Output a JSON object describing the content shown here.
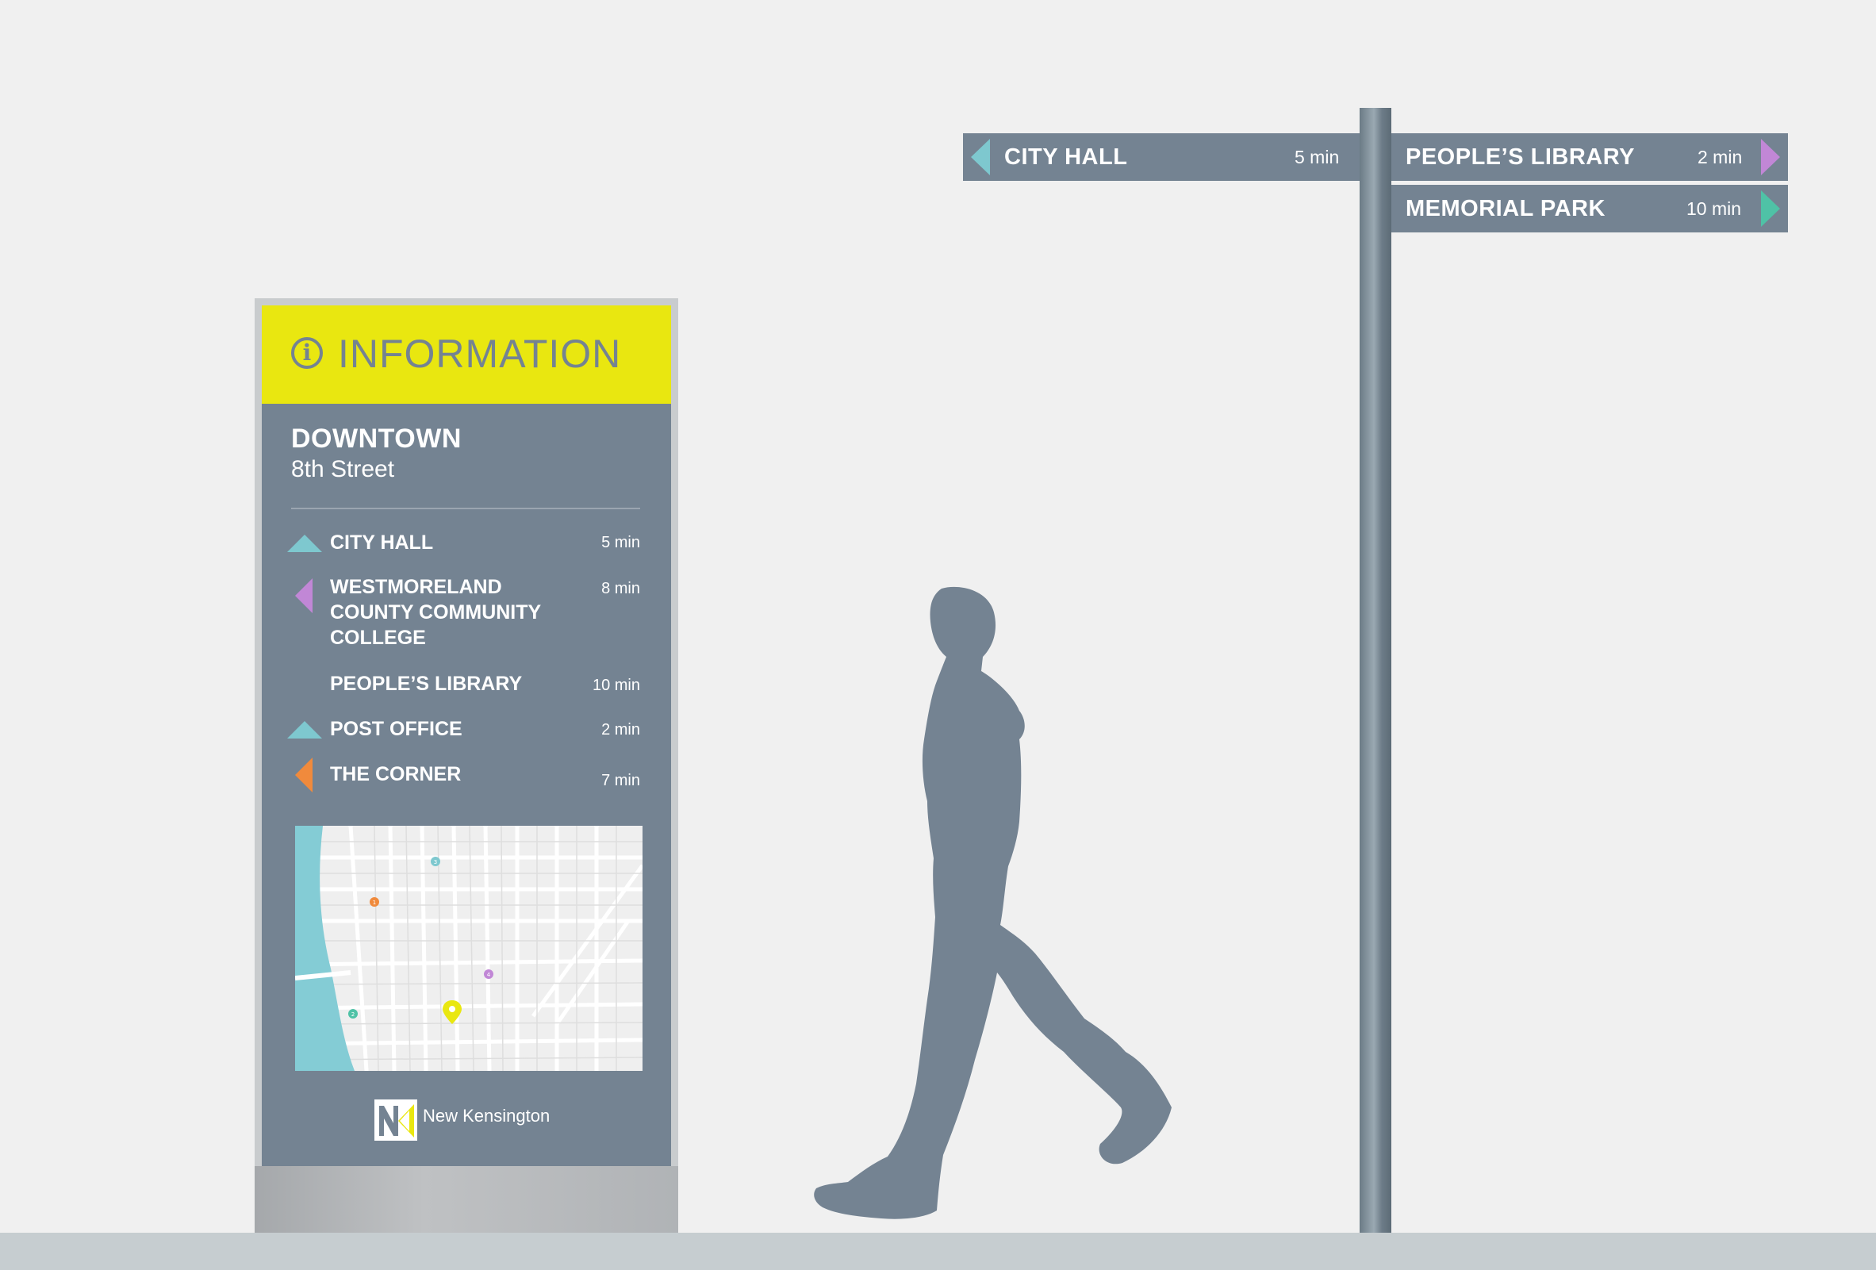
{
  "colors": {
    "background": "#f0f0f0",
    "ground": "#c6cdd0",
    "panel": "#748392",
    "header_yellow": "#e9e710",
    "arrow_teal": "#7ec8cf",
    "arrow_purple": "#c187d6",
    "arrow_green": "#4fc2a6",
    "arrow_orange": "#f08a3c"
  },
  "totem": {
    "header": {
      "icon": "info-circle-icon",
      "title": "INFORMATION"
    },
    "district": "DOWNTOWN",
    "street": "8th Street",
    "destinations": [
      {
        "name": "CITY HALL",
        "time": "5 min",
        "arrow": "up-triangle-icon",
        "arrow_color": "#7ec8cf"
      },
      {
        "name_lines": [
          "WESTMORELAND",
          "COUNTY COMMUNITY",
          "COLLEGE"
        ],
        "time": "8 min",
        "arrow": "left-triangle-icon",
        "arrow_color": "#c187d6"
      },
      {
        "name": "PEOPLE’S LIBRARY",
        "time": "10 min",
        "arrow": "none"
      },
      {
        "name": "POST OFFICE",
        "time": "2 min",
        "arrow": "up-triangle-icon",
        "arrow_color": "#7ec8cf"
      },
      {
        "name": "THE CORNER",
        "time": "7 min",
        "arrow": "left-triangle-icon",
        "arrow_color": "#f08a3c"
      }
    ],
    "map": {
      "markers": [
        {
          "label": "3",
          "color": "#7ec8cf"
        },
        {
          "label": "1",
          "color": "#f08a3c"
        },
        {
          "label": "4",
          "color": "#c187d6"
        },
        {
          "label": "2",
          "color": "#4fc2a6"
        },
        {
          "label": "",
          "color": "#e9e710",
          "icon": "location-pin-icon"
        }
      ]
    },
    "logo": {
      "mark": "NK",
      "text": "New Kensington"
    }
  },
  "signpost": {
    "blades": [
      {
        "name": "CITY HALL",
        "time": "5 min",
        "direction": "left",
        "arrow_color": "#7ec8cf"
      },
      {
        "name": "PEOPLE’S LIBRARY",
        "time": "2 min",
        "direction": "right",
        "arrow_color": "#c187d6"
      },
      {
        "name": "MEMORIAL PARK",
        "time": "10 min",
        "direction": "right",
        "arrow_color": "#4fc2a6"
      }
    ]
  }
}
